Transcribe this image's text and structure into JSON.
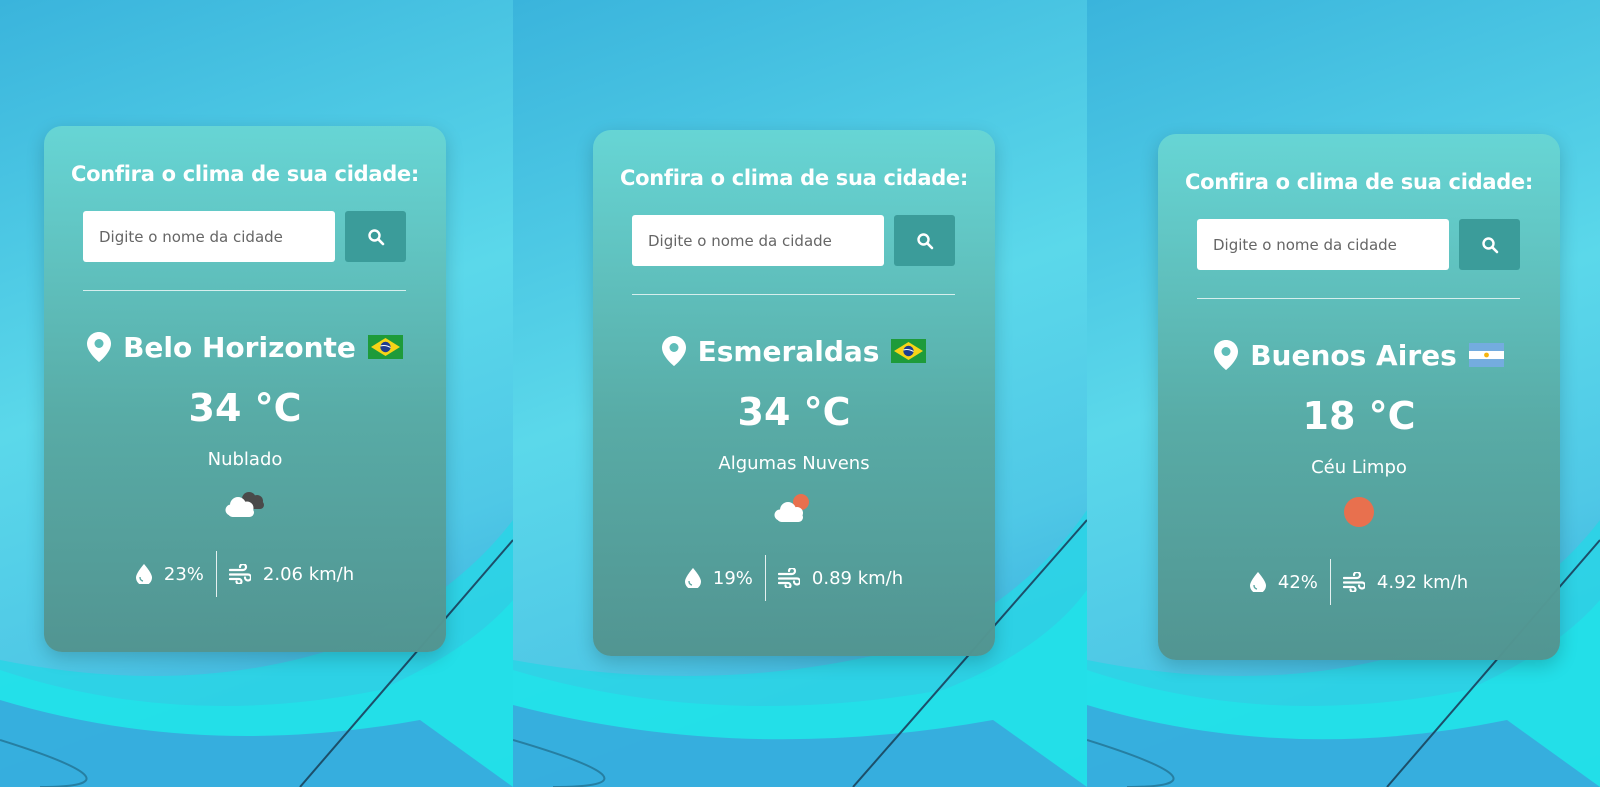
{
  "colors": {
    "accent": "#3b9c9a",
    "sun": "#e8704e",
    "card_top": "#68d6d4",
    "card_bottom": "#529490"
  },
  "cards": [
    {
      "title": "Confira o clima de sua cidade:",
      "search_placeholder": "Digite o nome da cidade",
      "city": "Belo Horizonte",
      "flag": "brazil-flag",
      "temperature": "34 °C",
      "description": "Nublado",
      "weather_icon": "broken-clouds-icon",
      "humidity": "23%",
      "wind": "2.06 km/h"
    },
    {
      "title": "Confira o clima de sua cidade:",
      "search_placeholder": "Digite o nome da cidade",
      "city": "Esmeraldas",
      "flag": "brazil-flag",
      "temperature": "34 °C",
      "description": "Algumas Nuvens",
      "weather_icon": "few-clouds-icon",
      "humidity": "19%",
      "wind": "0.89 km/h"
    },
    {
      "title": "Confira o clima de sua cidade:",
      "search_placeholder": "Digite o nome da cidade",
      "city": "Buenos Aires",
      "flag": "argentina-flag",
      "temperature": "18 °C",
      "description": "Céu Limpo",
      "weather_icon": "clear-sky-icon",
      "humidity": "42%",
      "wind": "4.92 km/h"
    }
  ]
}
